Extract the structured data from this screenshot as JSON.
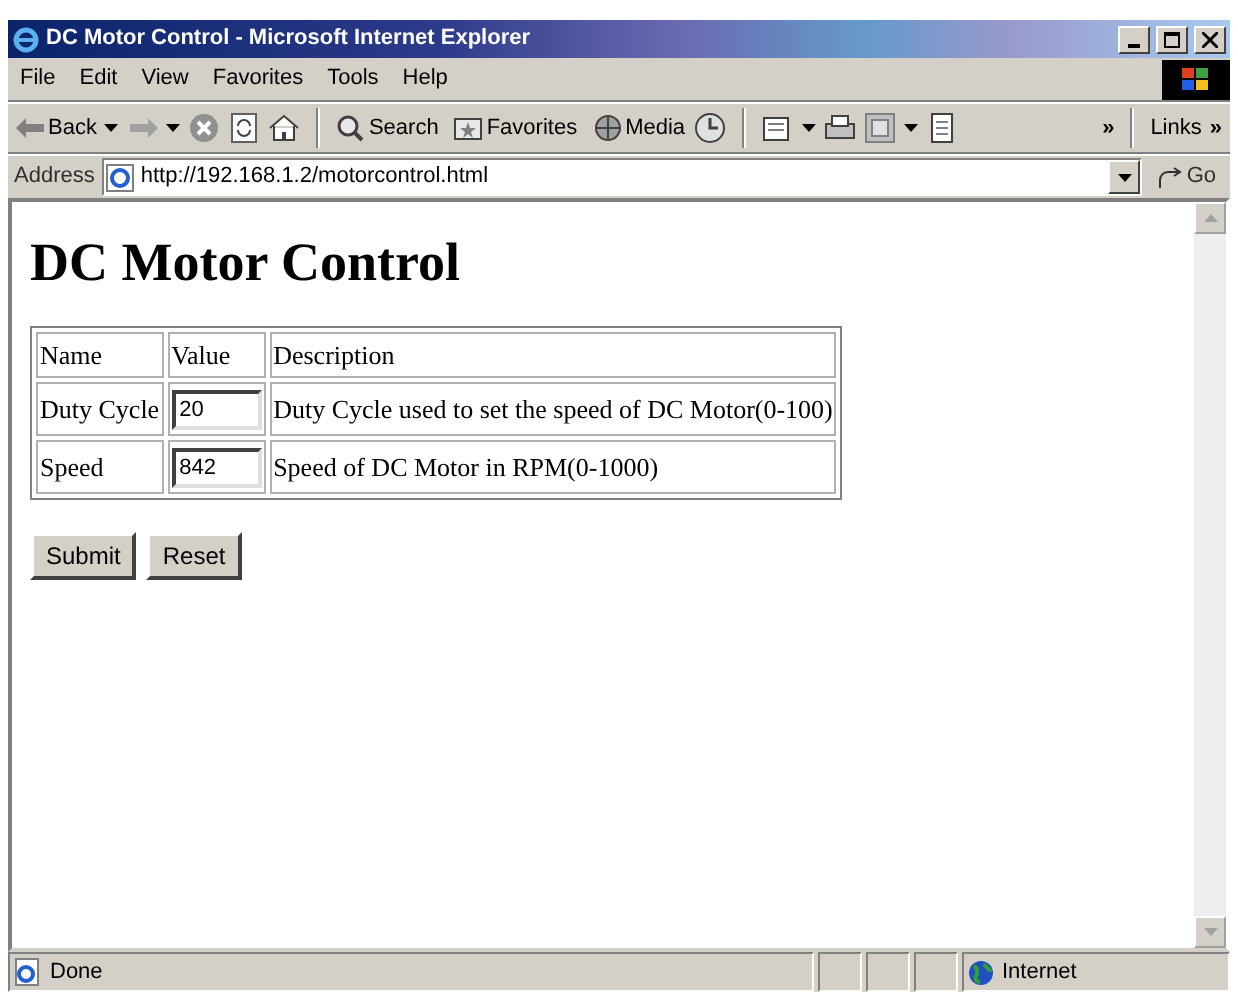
{
  "window": {
    "title": "DC Motor Control - Microsoft Internet Explorer"
  },
  "menu": [
    "File",
    "Edit",
    "View",
    "Favorites",
    "Tools",
    "Help"
  ],
  "toolbar": {
    "back": "Back",
    "search": "Search",
    "favorites": "Favorites",
    "media": "Media",
    "more": "»",
    "links": "Links",
    "links_more": "»"
  },
  "address": {
    "label": "Address",
    "url": "http://192.168.1.2/motorcontrol.html",
    "go": "Go"
  },
  "page": {
    "heading": "DC Motor Control",
    "table": {
      "columns": [
        "Name",
        "Value",
        "Description"
      ],
      "rows": [
        {
          "name": "Duty Cycle",
          "value": "20",
          "description": "Duty Cycle used to set the speed of DC Motor(0-100)"
        },
        {
          "name": "Speed",
          "value": "842",
          "description": "Speed of DC Motor in RPM(0-1000)"
        }
      ]
    },
    "buttons": [
      "Submit",
      "Reset"
    ]
  },
  "status_bar": {
    "text": "Done",
    "zone": "Internet"
  }
}
